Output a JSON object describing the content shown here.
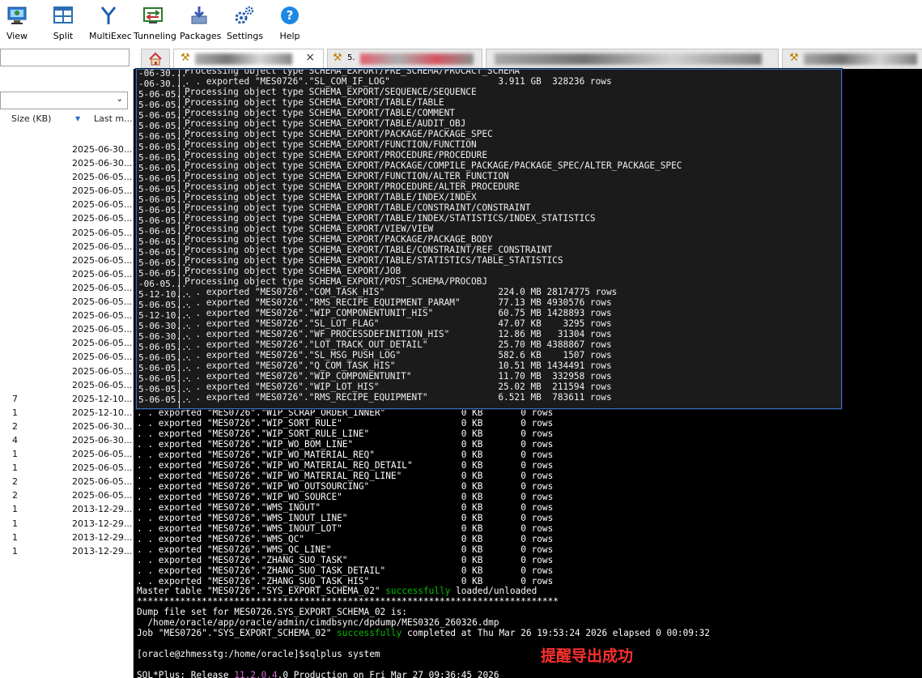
{
  "toolbar": {
    "items": [
      {
        "label": "View",
        "icon": "monitor-icon"
      },
      {
        "label": "Split",
        "icon": "split-window-icon"
      },
      {
        "label": "MultiExec",
        "icon": "multiexec-fork-icon"
      },
      {
        "label": "Tunneling",
        "icon": "tunneling-icon"
      },
      {
        "label": "Packages",
        "icon": "packages-icon"
      },
      {
        "label": "Settings",
        "icon": "gears-icon"
      },
      {
        "label": "Help",
        "icon": "help-icon"
      }
    ]
  },
  "file_browser": {
    "columns": {
      "size": "Size (KB)",
      "last_modified": "Last m..."
    },
    "rows": [
      {
        "size": "",
        "date": "2025-06-30..."
      },
      {
        "size": "",
        "date": "2025-06-30..."
      },
      {
        "size": "",
        "date": "2025-06-05..."
      },
      {
        "size": "",
        "date": "2025-06-05..."
      },
      {
        "size": "",
        "date": "2025-06-05..."
      },
      {
        "size": "",
        "date": "2025-06-05..."
      },
      {
        "size": "",
        "date": "2025-06-05..."
      },
      {
        "size": "",
        "date": "2025-06-05..."
      },
      {
        "size": "",
        "date": "2025-06-05..."
      },
      {
        "size": "",
        "date": "2025-06-05..."
      },
      {
        "size": "",
        "date": "2025-06-05..."
      },
      {
        "size": "",
        "date": "2025-06-05..."
      },
      {
        "size": "",
        "date": "2025-06-05..."
      },
      {
        "size": "",
        "date": "2025-06-05..."
      },
      {
        "size": "",
        "date": "2025-06-05..."
      },
      {
        "size": "",
        "date": "2025-06-05..."
      },
      {
        "size": "",
        "date": "2025-06-05..."
      },
      {
        "size": "",
        "date": "2025-06-05..."
      },
      {
        "size": "7",
        "date": "2025-12-10..."
      },
      {
        "size": "1",
        "date": "2025-12-10..."
      },
      {
        "size": "2",
        "date": "2025-06-30..."
      },
      {
        "size": "4",
        "date": "2025-06-30..."
      },
      {
        "size": "1",
        "date": "2025-06-05..."
      },
      {
        "size": "1",
        "date": "2025-06-05..."
      },
      {
        "size": "2",
        "date": "2025-06-05..."
      },
      {
        "size": "2",
        "date": "2025-06-05..."
      },
      {
        "size": "1",
        "date": "2013-12-29..."
      },
      {
        "size": "1",
        "date": "2013-12-29..."
      },
      {
        "size": "1",
        "date": "2013-12-29..."
      },
      {
        "size": "1",
        "date": "2013-12-29..."
      }
    ]
  },
  "tabs": [
    {
      "icon": "home-icon"
    },
    {
      "icon": "tool-icon",
      "close": "×"
    },
    {
      "icon": "tool-icon",
      "label": "5."
    },
    {
      "icon": "tool-icon"
    },
    {
      "icon": "tool-icon"
    }
  ],
  "terminal": {
    "lines": [
      ". . exported \"MES0726\".\"WIP_SCRAP_ORDER_INNER\"              0 KB       0 rows",
      ". . exported \"MES0726\".\"WIP_SORT_RULE\"                      0 KB       0 rows",
      ". . exported \"MES0726\".\"WIP_SORT_RULE_LINE\"                 0 KB       0 rows",
      ". . exported \"MES0726\".\"WIP_WO_BOM_LINE\"                    0 KB       0 rows",
      ". . exported \"MES0726\".\"WIP_WO_MATERIAL_REQ\"                0 KB       0 rows",
      ". . exported \"MES0726\".\"WIP_WO_MATERIAL_REQ_DETAIL\"         0 KB       0 rows",
      ". . exported \"MES0726\".\"WIP_WO_MATERIAL_REQ_LINE\"           0 KB       0 rows",
      ". . exported \"MES0726\".\"WIP_WO_OUTSOURCING\"                 0 KB       0 rows",
      ". . exported \"MES0726\".\"WIP_WO_SOURCE\"                      0 KB       0 rows",
      ". . exported \"MES0726\".\"WMS_INOUT\"                          0 KB       0 rows",
      ". . exported \"MES0726\".\"WMS_INOUT_LINE\"                     0 KB       0 rows",
      ". . exported \"MES0726\".\"WMS_INOUT_LOT\"                      0 KB       0 rows",
      ". . exported \"MES0726\".\"WMS_QC\"                             0 KB       0 rows",
      ". . exported \"MES0726\".\"WMS_QC_LINE\"                        0 KB       0 rows",
      ". . exported \"MES0726\".\"ZHANG_SUO_TASK\"                     0 KB       0 rows",
      ". . exported \"MES0726\".\"ZHANG_SUO_TASK_DETAIL\"              0 KB       0 rows",
      ". . exported \"MES0726\".\"ZHANG_SUO_TASK_HIS\"                 0 KB       0 rows"
    ],
    "master_prefix": "Master table \"MES0726\".\"SYS_EXPORT_SCHEMA_02\" ",
    "master_ok": "successfully",
    "master_suffix": " loaded/unloaded",
    "stars": "******************************************************************************",
    "dump_header": "Dump file set for MES0726.SYS_EXPORT_SCHEMA_02 is:",
    "dump_path": "  /home/oracle/app/oracle/admin/cimdbsync/dpdump/MES0326_260326.dmp",
    "job_prefix": "Job \"MES0726\".\"SYS_EXPORT_SCHEMA_02\" ",
    "job_ok": "successfully",
    "job_suffix": " completed at Thu Mar 26 19:53:24 2026 elapsed 0 00:09:32",
    "prompt": "[oracle@zhmesstg:/home/oracle]",
    "prompt_cmd": "$sqlplus system",
    "sqlplus_prefix": "SQL*Plus: Release ",
    "sqlplus_ver": "11.2.0.4",
    "sqlplus_suffix": ".0 Production on Fri Mar 27 09:36:45 2026"
  },
  "overlay": {
    "left": [
      "-06-30...",
      "-06-30...",
      "5-06-05...",
      "5-06-05...",
      "5-06-05...",
      "5-06-05...",
      "5-06-05...",
      "5-06-05...",
      "5-06-05...",
      "5-06-05...",
      "5-06-05...",
      "5-06-05...",
      "5-06-05...",
      "5-06-05...",
      "5-06-05...",
      "5-06-05...",
      "5-06-05...",
      "5-06-05...",
      "5-06-05...",
      "5-06-05...",
      "-06-05...",
      "5-12-10...",
      "5-06-05...",
      "5-12-10...",
      "5-06-30...",
      "5-06-30...",
      "5-06-05...",
      "5-06-05...",
      "5-06-05...",
      "5-06-05...",
      "5-06-05...",
      "5-06-05..."
    ],
    "right": [
      "Processing object type SCHEMA_EXPORT/PRE_SCHEMA/PROCACT_SCHEMA",
      ". . exported \"MES0726\".\"SL_COM_IF_LOG\"                    3.911 GB  328236 rows",
      "Processing object type SCHEMA_EXPORT/SEQUENCE/SEQUENCE",
      "Processing object type SCHEMA_EXPORT/TABLE/TABLE",
      "Processing object type SCHEMA_EXPORT/TABLE/COMMENT",
      "Processing object type SCHEMA_EXPORT/TABLE/AUDIT_OBJ",
      "Processing object type SCHEMA_EXPORT/PACKAGE/PACKAGE_SPEC",
      "Processing object type SCHEMA_EXPORT/FUNCTION/FUNCTION",
      "Processing object type SCHEMA_EXPORT/PROCEDURE/PROCEDURE",
      "Processing object type SCHEMA_EXPORT/PACKAGE/COMPILE_PACKAGE/PACKAGE_SPEC/ALTER_PACKAGE_SPEC",
      "Processing object type SCHEMA_EXPORT/FUNCTION/ALTER_FUNCTION",
      "Processing object type SCHEMA_EXPORT/PROCEDURE/ALTER_PROCEDURE",
      "Processing object type SCHEMA_EXPORT/TABLE/INDEX/INDEX",
      "Processing object type SCHEMA_EXPORT/TABLE/CONSTRAINT/CONSTRAINT",
      "Processing object type SCHEMA_EXPORT/TABLE/INDEX/STATISTICS/INDEX_STATISTICS",
      "Processing object type SCHEMA_EXPORT/VIEW/VIEW",
      "Processing object type SCHEMA_EXPORT/PACKAGE/PACKAGE_BODY",
      "Processing object type SCHEMA_EXPORT/TABLE/CONSTRAINT/REF_CONSTRAINT",
      "Processing object type SCHEMA_EXPORT/TABLE/STATISTICS/TABLE_STATISTICS",
      "Processing object type SCHEMA_EXPORT/JOB",
      "Processing object type SCHEMA_EXPORT/POST_SCHEMA/PROCOBJ",
      ". . exported \"MES0726\".\"COM_TASK_HIS\"                     224.0 MB 28174775 rows",
      ". . exported \"MES0726\".\"RMS_RECIPE_EQUIPMENT_PARAM\"       77.13 MB 4930576 rows",
      ". . exported \"MES0726\".\"WIP_COMPONENTUNIT_HIS\"            60.75 MB 1428893 rows",
      ". . exported \"MES0726\".\"SL_LOT_FLAG\"                      47.07 KB    3295 rows",
      ". . exported \"MES0726\".\"WF_PROCESSDEFINITION_HIS\"         12.86 MB   31304 rows",
      ". . exported \"MES0726\".\"LOT_TRACK_OUT_DETAIL\"             25.70 MB 4388867 rows",
      ". . exported \"MES0726\".\"SL_MSG_PUSH_LOG\"                  582.6 KB    1507 rows",
      ". . exported \"MES0726\".\"Q_COM_TASK_HIS\"                   10.51 MB 1434491 rows",
      ". . exported \"MES0726\".\"WIP_COMPONENTUNIT\"                11.70 MB  332958 rows",
      ". . exported \"MES0726\".\"WIP_LOT_HIS\"                      25.02 MB  211594 rows",
      ". . exported \"MES0726\".\"RMS_RECIPE_EQUIPMENT\"             6.521 MB  783611 rows"
    ]
  },
  "annotation": "提醒导出成功"
}
